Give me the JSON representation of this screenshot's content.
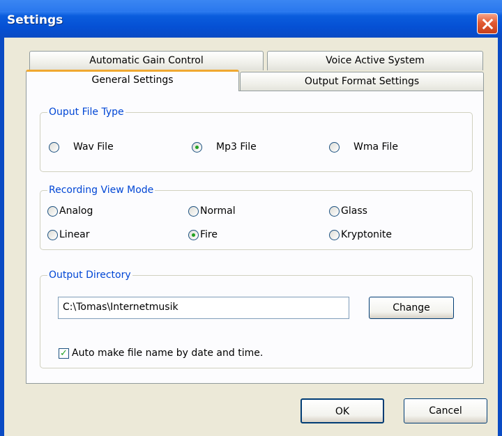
{
  "window": {
    "title": "Settings"
  },
  "tabs": {
    "automatic_gain_control": "Automatic Gain Control",
    "voice_active_system": "Voice Active System",
    "general_settings": "General Settings",
    "output_format_settings": "Output Format Settings",
    "active": "General Settings"
  },
  "output_file_type": {
    "legend": "Ouput File Type",
    "options": [
      "Wav File",
      "Mp3 File",
      "Wma File"
    ],
    "selected": "Mp3 File"
  },
  "recording_view_mode": {
    "legend": "Recording View Mode",
    "options": [
      "Analog",
      "Normal",
      "Glass",
      "Linear",
      "Fire",
      "Kryptonite"
    ],
    "selected": "Fire"
  },
  "output_directory": {
    "legend": "Output Directory",
    "path": "C:\\Tomas\\Internetmusik",
    "change_label": "Change",
    "auto_name_label": "Auto make file name by date and time.",
    "auto_name_checked": true
  },
  "buttons": {
    "ok": "OK",
    "cancel": "Cancel"
  },
  "colors": {
    "titlebar": "#0550d4",
    "legend": "#0046d5",
    "active_tab_accent": "#f0a830",
    "dialog_bg": "#ECE9D8"
  }
}
